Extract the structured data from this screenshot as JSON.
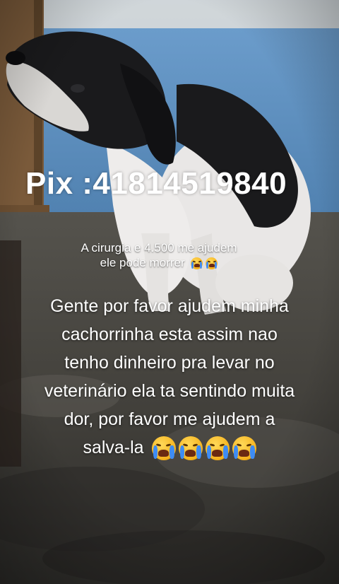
{
  "overlay": {
    "pix_text": "Pix :41814519840",
    "surgery_text": "A cirurgia e 4.500 me ajudem ele pode morrer",
    "surgery_emojis": [
      "loudly-crying-face",
      "loudly-crying-face"
    ],
    "main_lines": [
      "Gente por favor ajudem minha",
      "cachorrinha esta assim nao",
      "tenho dinheiro pra levar no",
      "veterinário ela ta sentindo muita",
      "dor, por favor me ajudem a",
      "salva-la"
    ],
    "main_emojis": [
      "loudly-crying-face",
      "loudly-crying-face",
      "loudly-crying-face",
      "loudly-crying-face"
    ]
  },
  "colors": {
    "wall": "#5e8fbf",
    "wood": "#7a5a3a",
    "dog_black": "#1a1a1c",
    "dog_white": "#e9e7e6",
    "floor": "#4b4944",
    "text": "#ffffff"
  }
}
